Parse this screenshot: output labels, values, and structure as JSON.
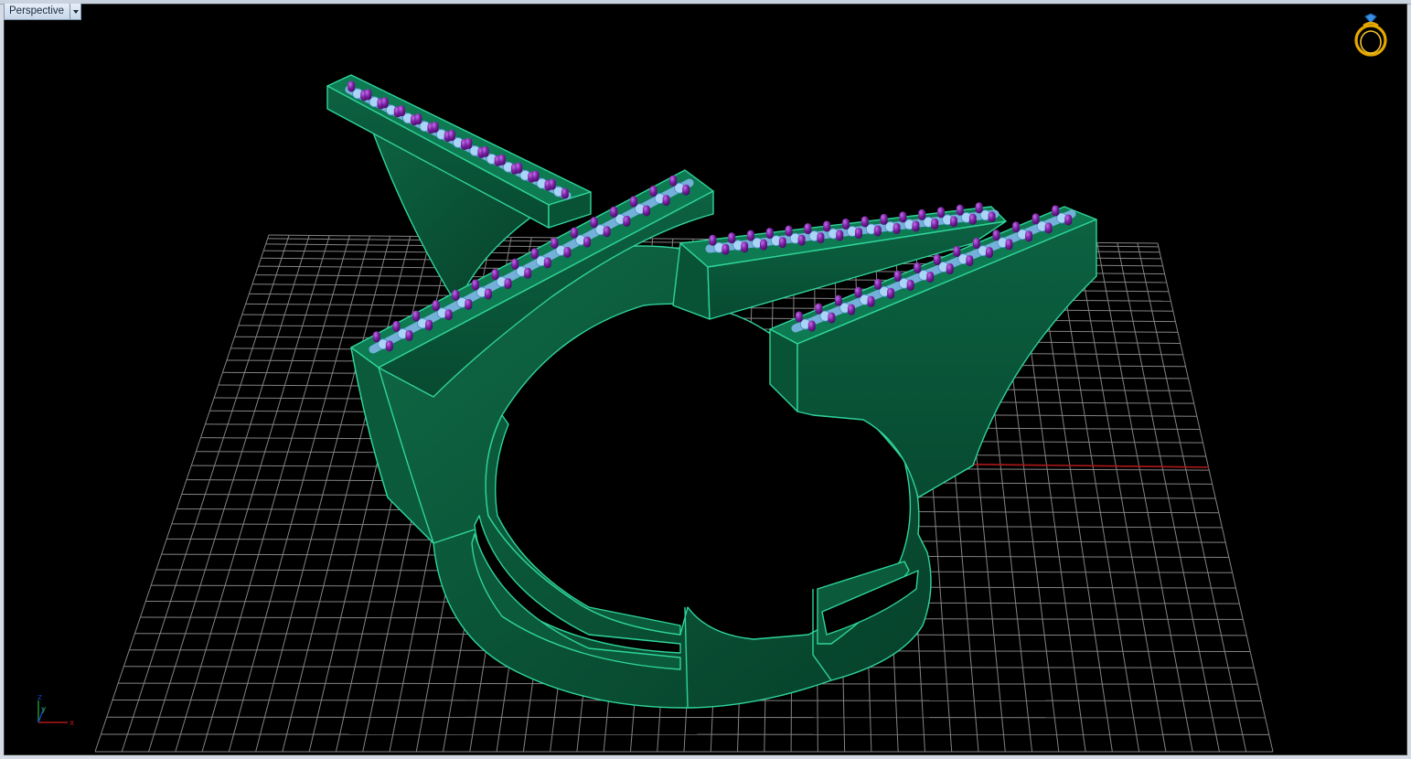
{
  "viewport": {
    "tab_label": "Perspective",
    "dropdown_icon": "chevron-down-icon"
  },
  "logo": {
    "icon": "ring-logo-icon"
  },
  "axes": {
    "x": "x",
    "y": "y",
    "z": "z"
  },
  "colors": {
    "background": "#000000",
    "grid": "#9a9a9a",
    "ring_fill": "#0b5a3c",
    "ring_edge": "#2fd49a",
    "setting_top": "#7fb7e8",
    "prongs": "#7a1fa2",
    "x_axis": "#b01818",
    "y_axis": "#1840c8",
    "logo_gold": "#e6a800"
  }
}
